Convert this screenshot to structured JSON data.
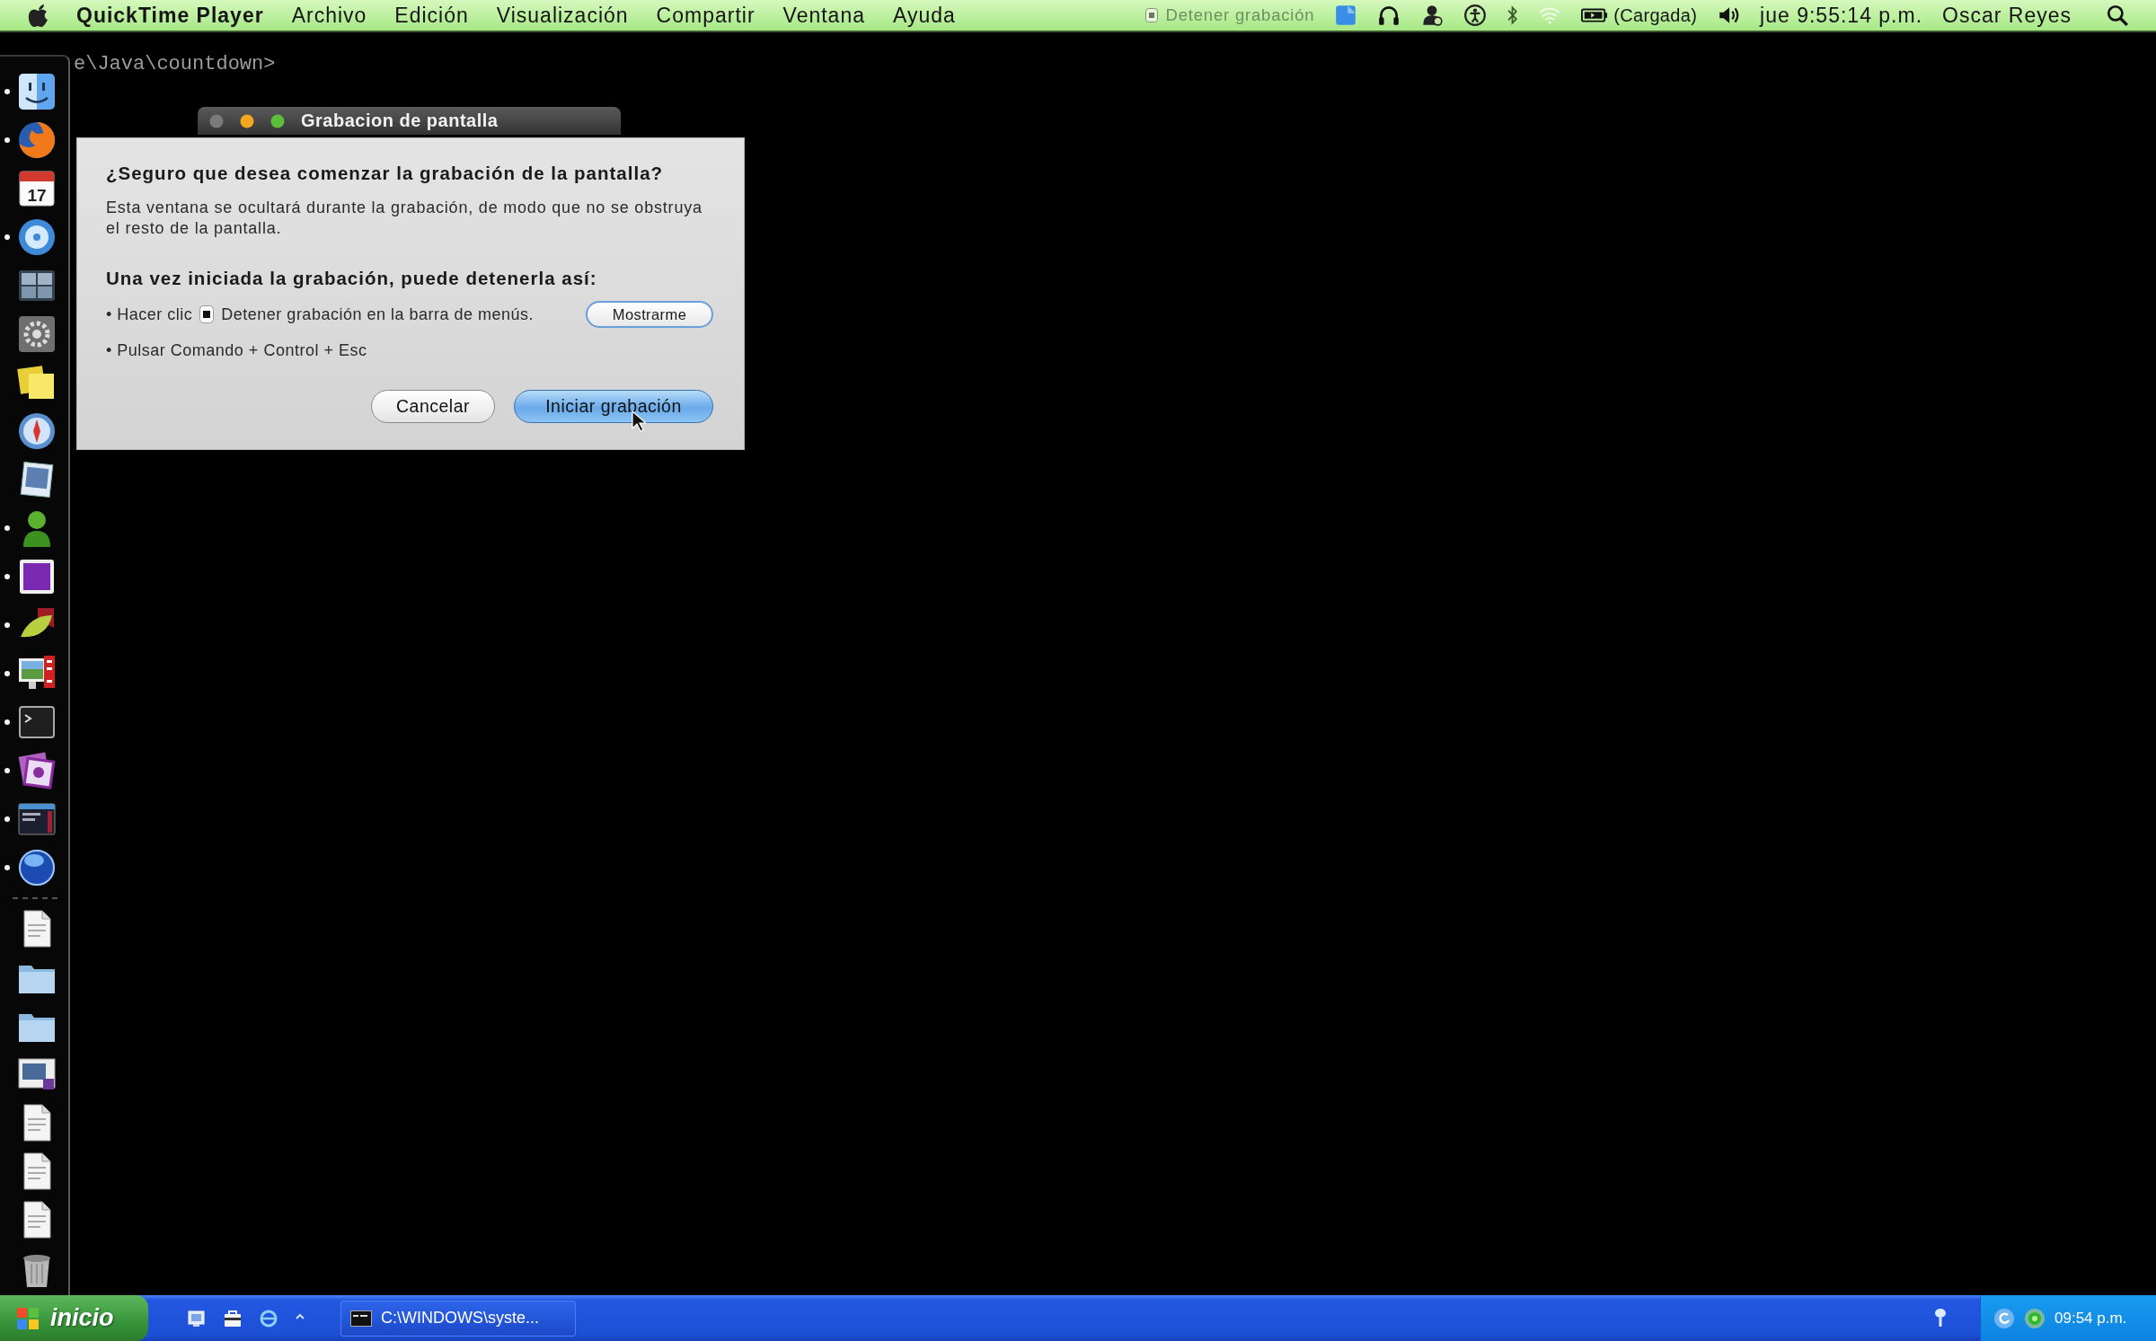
{
  "menu_bar": {
    "app_name": "QuickTime Player",
    "menus": [
      "Archivo",
      "Edición",
      "Visualización",
      "Compartir",
      "Ventana",
      "Ayuda"
    ],
    "recording_item": "Detener grabación",
    "battery": "(Cargada)",
    "clock": "jue 9:55:14 p.m.",
    "user": "Oscar Reyes"
  },
  "terminal": {
    "line": "e\\Java\\countdown>"
  },
  "dock": {
    "apps": [
      {
        "kind": "finder",
        "running": true
      },
      {
        "kind": "browser",
        "running": true
      },
      {
        "kind": "calendar",
        "running": false,
        "label": "17"
      },
      {
        "kind": "disc",
        "running": true
      },
      {
        "kind": "spaces",
        "running": false
      },
      {
        "kind": "gear",
        "running": false
      },
      {
        "kind": "notes",
        "running": false
      },
      {
        "kind": "compass",
        "running": false
      },
      {
        "kind": "photo_frame",
        "running": false
      },
      {
        "kind": "person",
        "running": true
      },
      {
        "kind": "tile",
        "running": true
      },
      {
        "kind": "leaf",
        "running": true
      },
      {
        "kind": "monitor",
        "running": true
      },
      {
        "kind": "terminal",
        "running": true
      },
      {
        "kind": "photo_stack",
        "running": true
      },
      {
        "kind": "window",
        "running": true
      },
      {
        "kind": "globe",
        "running": true
      }
    ],
    "stacks": [
      {
        "kind": "document"
      },
      {
        "kind": "folder"
      },
      {
        "kind": "folder"
      },
      {
        "kind": "screenshot"
      },
      {
        "kind": "document"
      },
      {
        "kind": "document"
      },
      {
        "kind": "document"
      },
      {
        "kind": "trash"
      }
    ]
  },
  "dialog": {
    "title": "Grabacion de pantalla",
    "heading": "¿Seguro que desea comenzar la grabación de la pantalla?",
    "message": "Esta ventana se ocultará durante la grabación, de modo que no se obstruya el resto de la pantalla.",
    "subheading": "Una vez iniciada la grabación, puede detenerla así:",
    "steps": [
      {
        "kind": "menu_click",
        "before": "• Hacer clic",
        "after": "Detener grabación en la barra de menús.",
        "button": "Mostrarme"
      },
      {
        "kind": "shortcut",
        "text": "• Pulsar Comando + Control + Esc"
      }
    ],
    "buttons": [
      {
        "label": "Cancelar",
        "default": false
      },
      {
        "label": "Iniciar grabación",
        "default": true
      }
    ]
  },
  "taskbar": {
    "start_label": "inicio",
    "tasks": [
      {
        "label": "C:\\WINDOWS\\syste...",
        "selected": false
      }
    ],
    "clock": "09:54 p.m."
  }
}
